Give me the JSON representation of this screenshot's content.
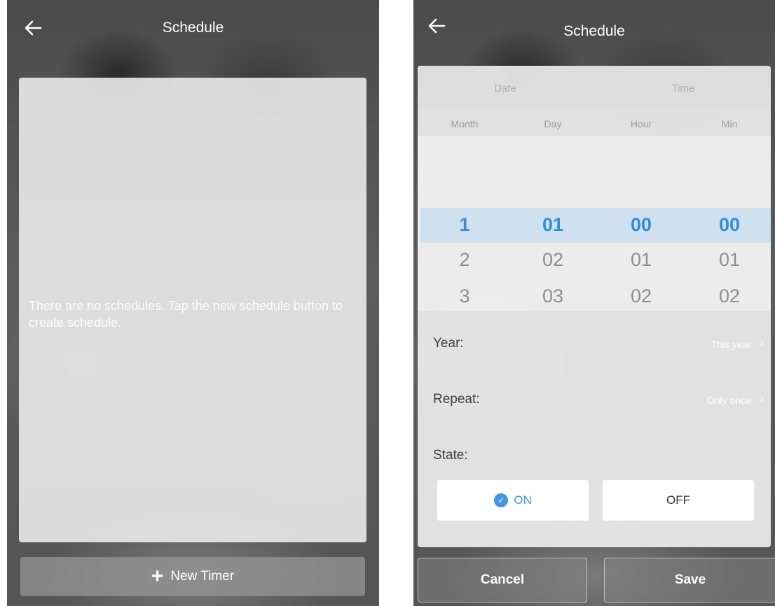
{
  "left_screen": {
    "title": "Schedule",
    "empty_message": "There are no schedules. Tap the new schedule button to create schedule.",
    "new_timer_label": "New Timer",
    "icons": {
      "back": "back-arrow-icon",
      "plus": "plus-icon"
    }
  },
  "right_screen": {
    "title": "Schedule",
    "segments": {
      "date": "Date",
      "time": "Time"
    },
    "columns": [
      "Month",
      "Day",
      "Hour",
      "Min"
    ],
    "wheel": {
      "selected": [
        "1",
        "01",
        "00",
        "00"
      ],
      "row2": [
        "2",
        "02",
        "01",
        "01"
      ],
      "row3": [
        "3",
        "03",
        "02",
        "02"
      ]
    },
    "year": {
      "label": "Year:",
      "value": "This year"
    },
    "repeat": {
      "label": "Repeat:",
      "value": "Only once"
    },
    "state": {
      "label": "State:",
      "on": "ON",
      "off": "OFF",
      "selected": "ON"
    },
    "cancel_label": "Cancel",
    "save_label": "Save",
    "accent_color": "#3d96e6"
  }
}
